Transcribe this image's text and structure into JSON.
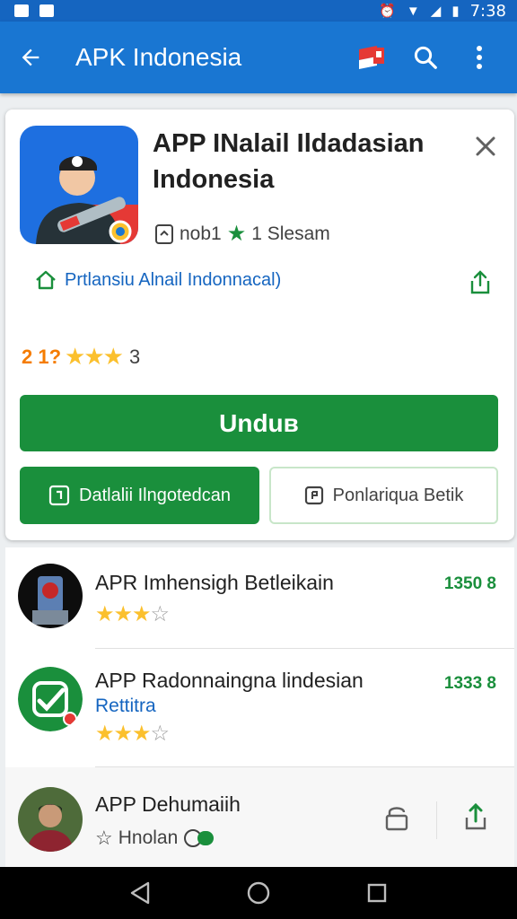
{
  "status_bar": {
    "time": "7:38"
  },
  "app_bar": {
    "title": "APK Indonesia"
  },
  "app": {
    "title": "APP INalail Ildadasian Indonesia",
    "developer_code": "nob1",
    "installs": "1 Slesam",
    "developer_link": "Prtlansiu Alnail Indonnacal)",
    "rating": "2 1?",
    "rating_count": "3",
    "install_label": "Unduʙ",
    "detail_label": "Datlalii Ilngotedcan",
    "report_label": "Ponlariqua Betik"
  },
  "list": [
    {
      "name": "APR Imhensigh Betleikain",
      "size": "1350 8",
      "stars": 3
    },
    {
      "name": "APP Radonnaingna lindesian",
      "sub": "Rettitra",
      "size": "1333 8",
      "stars": 3
    },
    {
      "name": "APP Dehumaiih",
      "sub": "Hnolan"
    }
  ],
  "colors": {
    "primary": "#1976d2",
    "install_green": "#1a8f3c",
    "star": "#fbc02d"
  }
}
